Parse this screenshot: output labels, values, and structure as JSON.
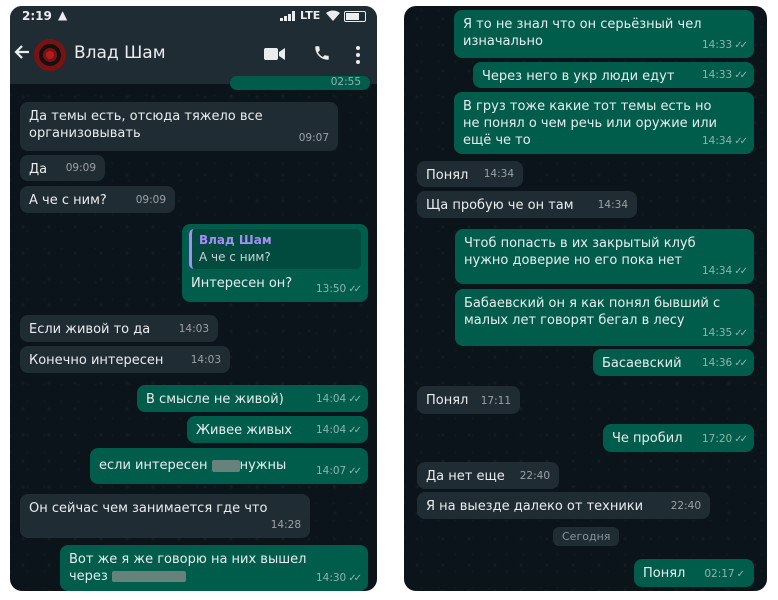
{
  "left": {
    "status": {
      "time": "2:19",
      "network": "LTE"
    },
    "header": {
      "contact_name": "Влад Шам"
    },
    "top_partial_time": "02:55",
    "messages": [
      {
        "text1": "Да темы есть, отсюда тяжело все",
        "text2": "организовывать",
        "time": "09:07"
      },
      {
        "text": "Да",
        "time": "09:09"
      },
      {
        "text": "А че с ним?",
        "time": "09:09"
      },
      {
        "reply_name": "Влад Шам",
        "reply_text": "А че с ним?",
        "text": "Интересен он?",
        "time": "13:50"
      },
      {
        "text": "Если живой то да",
        "time": "14:03"
      },
      {
        "text": "Конечно интересен",
        "time": "14:03"
      },
      {
        "text": "В смысле не живой)",
        "time": "14:04"
      },
      {
        "text": "Живее живых",
        "time": "14:04"
      },
      {
        "text_before": "если интересен",
        "text_after": "нужны",
        "time": "14:07"
      },
      {
        "text": "Он сейчас чем занимается где что",
        "time": "14:28"
      },
      {
        "text1": "Вот же я же говорю на них вышел",
        "text2": "через",
        "time": "14:30"
      }
    ]
  },
  "right": {
    "messages": [
      {
        "text1": "Я то не знал что он серьёзный чел",
        "text2": "изначально",
        "time": "14:33"
      },
      {
        "text": "Через него в укр люди едут",
        "time": "14:33"
      },
      {
        "text1": "В груз тоже какие тот темы есть но",
        "text2": "не понял о чем речь или оружие или",
        "text3": "ещё че то",
        "time": "14:34"
      },
      {
        "text": "Понял",
        "time": "14:34"
      },
      {
        "text": "Ща пробую че он там",
        "time": "14:34"
      },
      {
        "text1": "Чтоб попасть в их закрытый клуб",
        "text2": "нужно доверие но его пока нет",
        "time": "14:34"
      },
      {
        "text1": "Бабаевский он я как понял бывший с",
        "text2": "малых лет говорят бегал в лесу",
        "time": "14:35"
      },
      {
        "text": "Басаевский",
        "time": "14:36"
      },
      {
        "text": "Понял",
        "time": "17:11"
      },
      {
        "text": "Че пробил",
        "time": "17:20"
      },
      {
        "text": "Да нет еще",
        "time": "22:40"
      },
      {
        "text": "Я на выезде далеко от техники",
        "time": "22:40"
      },
      {
        "date": "Сегодня"
      },
      {
        "text": "Понял",
        "time": "02:17"
      }
    ]
  },
  "colors": {
    "incoming": "#202c33",
    "outgoing": "#005c4b",
    "background": "#0b141a",
    "header": "#1f2c34",
    "quote_accent": "#a78bfa"
  },
  "icons": [
    "back-arrow-icon",
    "avatar",
    "video-call-icon",
    "phone-icon",
    "more-vert-icon",
    "double-check-icon",
    "single-check-icon"
  ]
}
